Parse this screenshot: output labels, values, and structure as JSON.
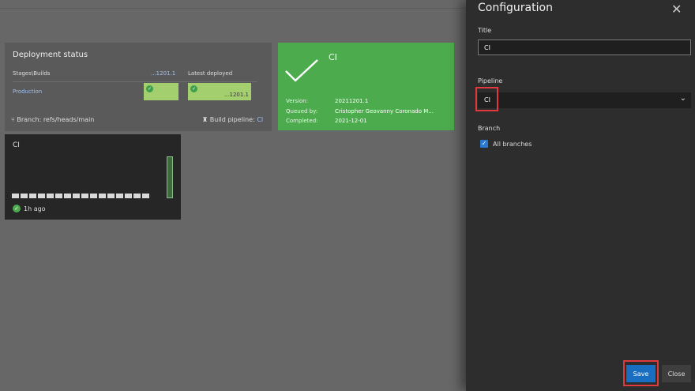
{
  "deployment": {
    "title": "Deployment status",
    "col_stages": "Stages\\Builds",
    "col_build": "...1201.1",
    "col_latest": "Latest deployed",
    "environment": "Production",
    "tile2_text": "...1201.1",
    "branch": "Branch: refs/heads/main",
    "pipeline_label": "Build pipeline:",
    "pipeline_value": "CI"
  },
  "build_card": {
    "name": "CI",
    "version_label": "Version:",
    "version": "20211201.1",
    "queued_label": "Queued by:",
    "queued": "Cristopher Geovanny Coronado M...",
    "completed_label": "Completed:",
    "completed": "2021-12-01",
    "color": "#4cab4d"
  },
  "history": {
    "title": "CI",
    "ago": "1h ago"
  },
  "config": {
    "title": "Configuration",
    "title_label": "Title",
    "title_value": "CI",
    "pipeline_label": "Pipeline",
    "pipeline_value": "CI",
    "branch_label": "Branch",
    "all_branches": "All branches",
    "all_branches_checked": true,
    "save": "Save",
    "close": "Close",
    "accent": "#1a6ec2",
    "highlight": "#e0393e"
  },
  "icons": {
    "branch": "branch-icon",
    "pipeline": "pipeline-icon",
    "close": "close-icon",
    "chevron": "chevron-down-icon",
    "check": "check-icon"
  }
}
